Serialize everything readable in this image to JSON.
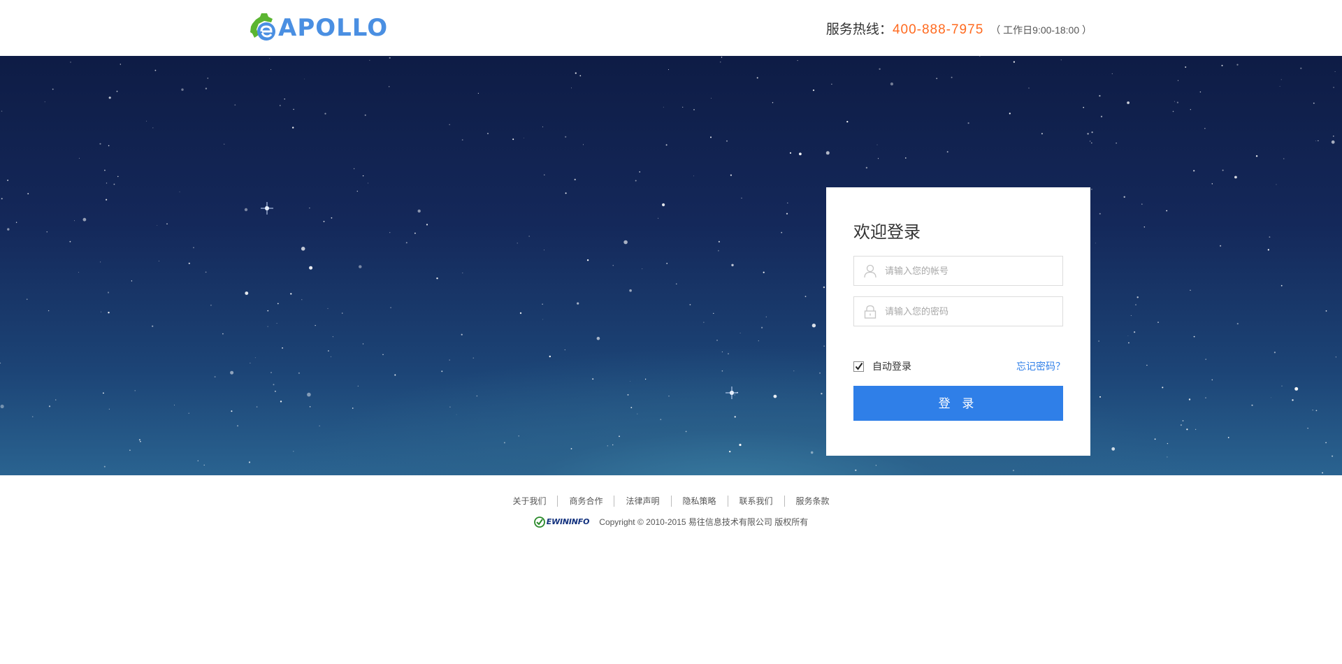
{
  "header": {
    "logo_text": "APOLLO",
    "hotline_label": "服务热线：",
    "hotline_number": "400-888-7975",
    "hotline_hours": "（ 工作日9:00-18:00 ）"
  },
  "login": {
    "title": "欢迎登录",
    "username_placeholder": "请输入您的帐号",
    "password_placeholder": "请输入您的密码",
    "remember_label": "自动登录",
    "remember_checked": true,
    "forgot_label": "忘记密码？",
    "submit_label": "登 录"
  },
  "footer": {
    "links": [
      "关于我们",
      "商务合作",
      "法律声明",
      "隐私策略",
      "联系我们",
      "服务条款"
    ],
    "company_logo_text": "EWININFO",
    "copyright": "Copyright © 2010-2015 易往信息技术有限公司 版权所有"
  },
  "colors": {
    "accent": "#2f7fe8",
    "hotline": "#ff6a1f",
    "logo_blue": "#4a8fe2",
    "logo_green": "#5bb531"
  }
}
